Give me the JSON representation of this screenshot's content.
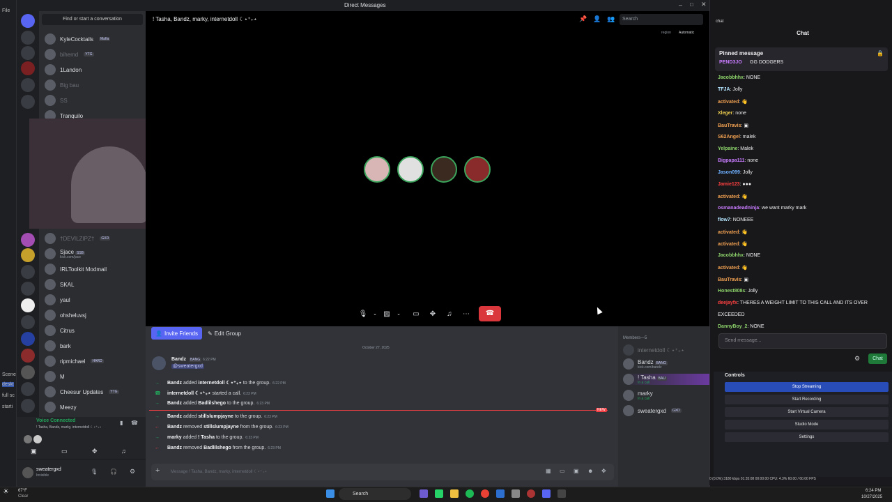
{
  "window": {
    "title": "Direct Messages"
  },
  "colors": {
    "blurple": "#5865f2",
    "green": "#23a55a",
    "red": "#da373c",
    "twitch_bg": "#18181b",
    "obs_active": "#284cb8"
  },
  "obs_left": {
    "file_label": "File",
    "scene_label": "Scene",
    "sub_labels": [
      "deskt",
      "full sc",
      "starti"
    ]
  },
  "dm_sidebar": {
    "search_placeholder": "Find or start a conversation",
    "items": [
      {
        "name": "KyleCocktails",
        "tag": "Mafia",
        "dim": false
      },
      {
        "name": "bihemd",
        "tag": "YTG",
        "dim": true
      },
      {
        "name": "1Landon",
        "tag": "",
        "dim": false
      },
      {
        "name": "Big bau",
        "tag": "",
        "dim": true
      },
      {
        "name": "SS",
        "tag": "",
        "dim": true
      },
      {
        "name": "Tranquilo",
        "tag": "",
        "dim": false
      },
      {
        "name": "†DEVILZIPZ†",
        "tag": "GXD",
        "dim": true
      },
      {
        "name": "Sjace",
        "tag": "SSB",
        "sub": "kick.com/jace",
        "dim": false
      },
      {
        "name": "IRLToolkit Modmail",
        "tag": "",
        "dim": false
      },
      {
        "name": "SKAL",
        "tag": "",
        "dim": false
      },
      {
        "name": "yaul",
        "tag": "",
        "dim": false
      },
      {
        "name": "ohsheluvsj",
        "tag": "",
        "dim": false
      },
      {
        "name": "Citrus",
        "tag": "",
        "dim": false
      },
      {
        "name": "bark",
        "tag": "",
        "dim": false
      },
      {
        "name": "ripmichael",
        "tag": "HARD",
        "dim": false
      },
      {
        "name": "M",
        "tag": "",
        "dim": false
      },
      {
        "name": "Cheesur Updates",
        "tag": "YTG",
        "dim": false
      },
      {
        "name": "Meezy",
        "tag": "",
        "dim": false
      }
    ]
  },
  "voice_panel": {
    "status": "Voice Connected",
    "channel": "! Tasha, Bandz, marky, internetdoll ☾⋆⁺₊⋆"
  },
  "user_panel": {
    "username": "sweatergxd",
    "status": "Invisible"
  },
  "call": {
    "header_title": "! Tasha, Bandz, marky, internetdoll ☾⋆⁺₊⋆",
    "search_placeholder": "Search",
    "region_label": "region",
    "region_value": "Automatic"
  },
  "chat": {
    "invite_label": "Invite Friends",
    "edit_label": "Edit Group",
    "date_divider": "October 27, 2025",
    "first_message": {
      "author": "Bandz",
      "tag": "BANG",
      "time": "6:22 PM",
      "mention": "@sweatergxd"
    },
    "system_messages": [
      {
        "arrow": "→",
        "color": "green",
        "actor": "Bandz",
        "verb": "added",
        "target": "internetdoll ☾⋆⁺₊⋆",
        "rest": "to the group.",
        "time": "6:22 PM"
      },
      {
        "arrow": "☎",
        "color": "green",
        "actor": "internetdoll ☾⋆⁺₊⋆",
        "verb": "started a call.",
        "target": "",
        "rest": "",
        "time": "6:23 PM"
      },
      {
        "arrow": "→",
        "color": "green",
        "actor": "Bandz",
        "verb": "added",
        "target": "Badlilshego",
        "rest": "to the group.",
        "time": "6:23 PM"
      },
      {
        "arrow": "→",
        "color": "green",
        "actor": "Bandz",
        "verb": "added",
        "target": "stillslumpjayne",
        "rest": "to the group.",
        "time": "6:23 PM"
      },
      {
        "arrow": "←",
        "color": "red",
        "actor": "Bandz",
        "verb": "removed",
        "target": "stillslumpjayne",
        "rest": "from the group.",
        "time": "6:23 PM"
      },
      {
        "arrow": "→",
        "color": "green",
        "actor": "marky",
        "verb": "added",
        "target": "! Tasha",
        "rest": "to the group.",
        "time": "6:23 PM"
      },
      {
        "arrow": "←",
        "color": "red",
        "actor": "Bandz",
        "verb": "removed",
        "target": "Badlilshego",
        "rest": "from the group.",
        "time": "6:23 PM"
      }
    ],
    "new_badge": "NEW",
    "input_placeholder": "Message ! Tasha, Bandz, marky, internetdoll ☾⋆⁺₊⋆"
  },
  "members": {
    "header": "Members—5",
    "list": [
      {
        "name": "internetdoll ☾⋆⁺₊⋆",
        "sub": "",
        "dim": true
      },
      {
        "name": "Bandz",
        "tag": "BANG",
        "sub": "kick.com/bandz"
      },
      {
        "name": "! Tasha",
        "tag": "BAU",
        "sub": "In a call"
      },
      {
        "name": "marky",
        "sub": "In a call"
      },
      {
        "name": "sweatergxd",
        "tag": "GXD",
        "sub": ""
      }
    ]
  },
  "twitch": {
    "dock_title": "chat",
    "header": "Chat",
    "pinned_label": "Pinned message",
    "pinned": {
      "user": "PEND3JO",
      "text": "GG DODGERS"
    },
    "messages": [
      {
        "user": "Jacobbhhx",
        "color": "#8dd36a",
        "text": "NONE"
      },
      {
        "user": "TFJA",
        "color": "#b5e6ff",
        "text": "Jolly"
      },
      {
        "user": "activated",
        "color": "#f0a050",
        "text": "👋"
      },
      {
        "user": "Xleger",
        "color": "#f0d050",
        "text": "none"
      },
      {
        "user": "BauTravis",
        "color": "#f0a050",
        "text": "▣"
      },
      {
        "user": "S62Angel",
        "color": "#f0a050",
        "text": "malek"
      },
      {
        "user": "Yelpaine",
        "color": "#8dd36a",
        "text": "Malek"
      },
      {
        "user": "Bigpapa111",
        "color": "#c97cff",
        "text": "none"
      },
      {
        "user": "Jason099",
        "color": "#6fb0ff",
        "text": "Jolly"
      },
      {
        "user": "Jamie123",
        "color": "#ff4040",
        "text": "●●●"
      },
      {
        "user": "activated",
        "color": "#f0a050",
        "text": "👋"
      },
      {
        "user": "osmanadeadninja",
        "color": "#c97cff",
        "text": "we want marky mark"
      },
      {
        "user": "flow7",
        "color": "#b5e6ff",
        "text": "NONEEE"
      },
      {
        "user": "activated",
        "color": "#f0a050",
        "text": "👋"
      },
      {
        "user": "activated",
        "color": "#f0a050",
        "text": "👋"
      },
      {
        "user": "Jacobbhhx",
        "color": "#8dd36a",
        "text": "NONE"
      },
      {
        "user": "activated",
        "color": "#f0a050",
        "text": "👋"
      },
      {
        "user": "BauTravis",
        "color": "#f0a050",
        "text": "▣"
      },
      {
        "user": "Honest808s",
        "color": "#8dd36a",
        "text": "Jolly"
      },
      {
        "user": "deejayfx",
        "color": "#ff4040",
        "text": "THERES A WEIGHT LIMIT TO THIS CALL AND ITS OVER"
      },
      {
        "user": "",
        "color": "#efeff1",
        "text": "EXCEEDED"
      },
      {
        "user": "DannyBoy_2",
        "color": "#8dd36a",
        "text": "NONE"
      }
    ],
    "send_placeholder": "Send message...",
    "chat_button": "Chat"
  },
  "obs_controls": {
    "title": "Controls",
    "buttons": [
      "Stop Streaming",
      "Start Recording",
      "Start Virtual Camera",
      "Studio Mode",
      "Settings"
    ],
    "status_bar": "0 (0.0%)   3180 kbps   01:35:08   00:00:00   CPU: 4.3%   60.00 / 60.00 FPS"
  },
  "taskbar": {
    "search": "Search",
    "weather_temp": "67°F",
    "weather_desc": "Clear",
    "time": "6:24 PM",
    "date": "10/27/2025"
  }
}
